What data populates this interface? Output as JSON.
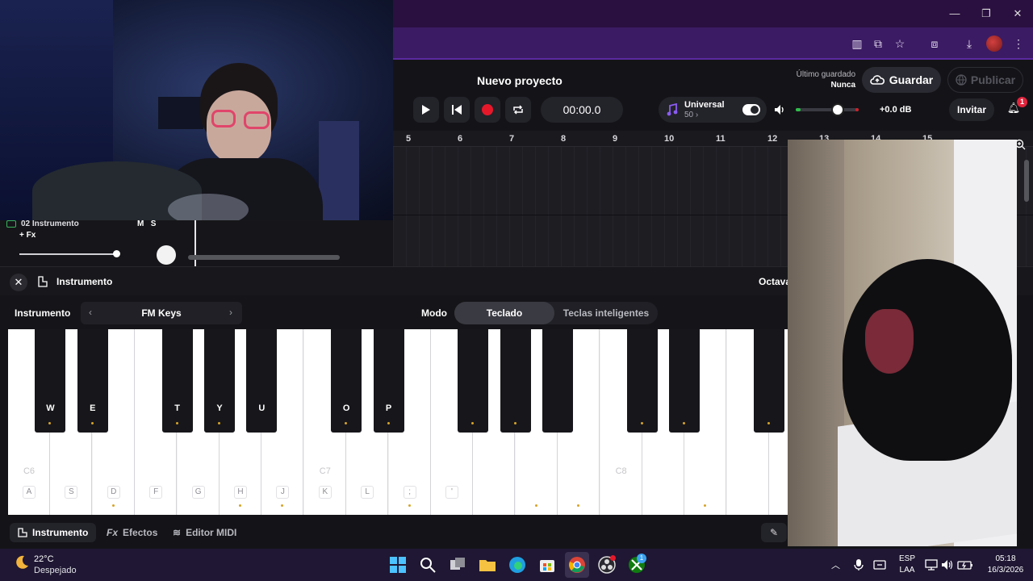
{
  "browser": {
    "minimize": "—",
    "maximize": "❐",
    "close": "✕"
  },
  "header": {
    "project_title": "Nuevo proyecto",
    "last_saved_label": "Último guardado",
    "last_saved_value": "Nunca",
    "save_label": "Guardar",
    "publish_label": "Publicar",
    "time": "00:00.0",
    "universal_name": "Universal",
    "universal_value": "50 ›",
    "volume_db": "+0.0 dB",
    "invite_label": "Invitar",
    "notification_count": "1"
  },
  "ruler": [
    "5",
    "6",
    "7",
    "8",
    "9",
    "10",
    "11",
    "12",
    "13",
    "14",
    "15"
  ],
  "track": {
    "name": "02 Instrumento",
    "fx": "+ Fx",
    "mute": "M",
    "solo": "S"
  },
  "panel": {
    "title": "Instrumento",
    "octave": "Octava"
  },
  "instrument": {
    "label": "Instrumento",
    "value": "FM Keys",
    "mode_label": "Modo",
    "mode_keyboard": "Teclado",
    "mode_smart": "Teclas inteligentes"
  },
  "white_keys": [
    {
      "note": "C6",
      "kbd": "A",
      "dot": false
    },
    {
      "note": "",
      "kbd": "S",
      "dot": false
    },
    {
      "note": "",
      "kbd": "D",
      "dot": true
    },
    {
      "note": "",
      "kbd": "F",
      "dot": false
    },
    {
      "note": "",
      "kbd": "G",
      "dot": false
    },
    {
      "note": "",
      "kbd": "H",
      "dot": true
    },
    {
      "note": "",
      "kbd": "J",
      "dot": true
    },
    {
      "note": "C7",
      "kbd": "K",
      "dot": false
    },
    {
      "note": "",
      "kbd": "L",
      "dot": false
    },
    {
      "note": "",
      "kbd": ";",
      "dot": true
    },
    {
      "note": "",
      "kbd": "'",
      "dot": false
    },
    {
      "note": "",
      "kbd": "",
      "dot": false
    },
    {
      "note": "",
      "kbd": "",
      "dot": true
    },
    {
      "note": "",
      "kbd": "",
      "dot": true
    },
    {
      "note": "C8",
      "kbd": "",
      "dot": false
    },
    {
      "note": "",
      "kbd": "",
      "dot": false
    },
    {
      "note": "",
      "kbd": "",
      "dot": true
    },
    {
      "note": "",
      "kbd": "",
      "dot": false
    },
    {
      "note": "",
      "kbd": "",
      "dot": false
    }
  ],
  "black_keys": [
    {
      "kbd": "W",
      "dot": true
    },
    {
      "kbd": "E",
      "dot": true
    },
    {
      "kbd": "T",
      "dot": true
    },
    {
      "kbd": "Y",
      "dot": true
    },
    {
      "kbd": "U",
      "dot": false
    },
    {
      "kbd": "O",
      "dot": true
    },
    {
      "kbd": "P",
      "dot": true
    },
    {
      "kbd": "",
      "dot": true
    },
    {
      "kbd": "",
      "dot": true
    },
    {
      "kbd": "",
      "dot": false
    },
    {
      "kbd": "",
      "dot": true
    },
    {
      "kbd": "",
      "dot": true
    },
    {
      "kbd": "",
      "dot": true
    }
  ],
  "tabs": {
    "instrument": "Instrumento",
    "effects": "Efectos",
    "midi": "Editor MIDI"
  },
  "taskbar": {
    "temperature": "22°C",
    "condition": "Despejado",
    "lang_1": "ESP",
    "lang_2": "LAA",
    "time": "05:18",
    "date": "16/3/2026",
    "xbox_badge": "1"
  },
  "colors": {
    "accent_record": "#e5182a",
    "browser_purple": "#3b1b63",
    "key_dot": "#d6a42a"
  }
}
